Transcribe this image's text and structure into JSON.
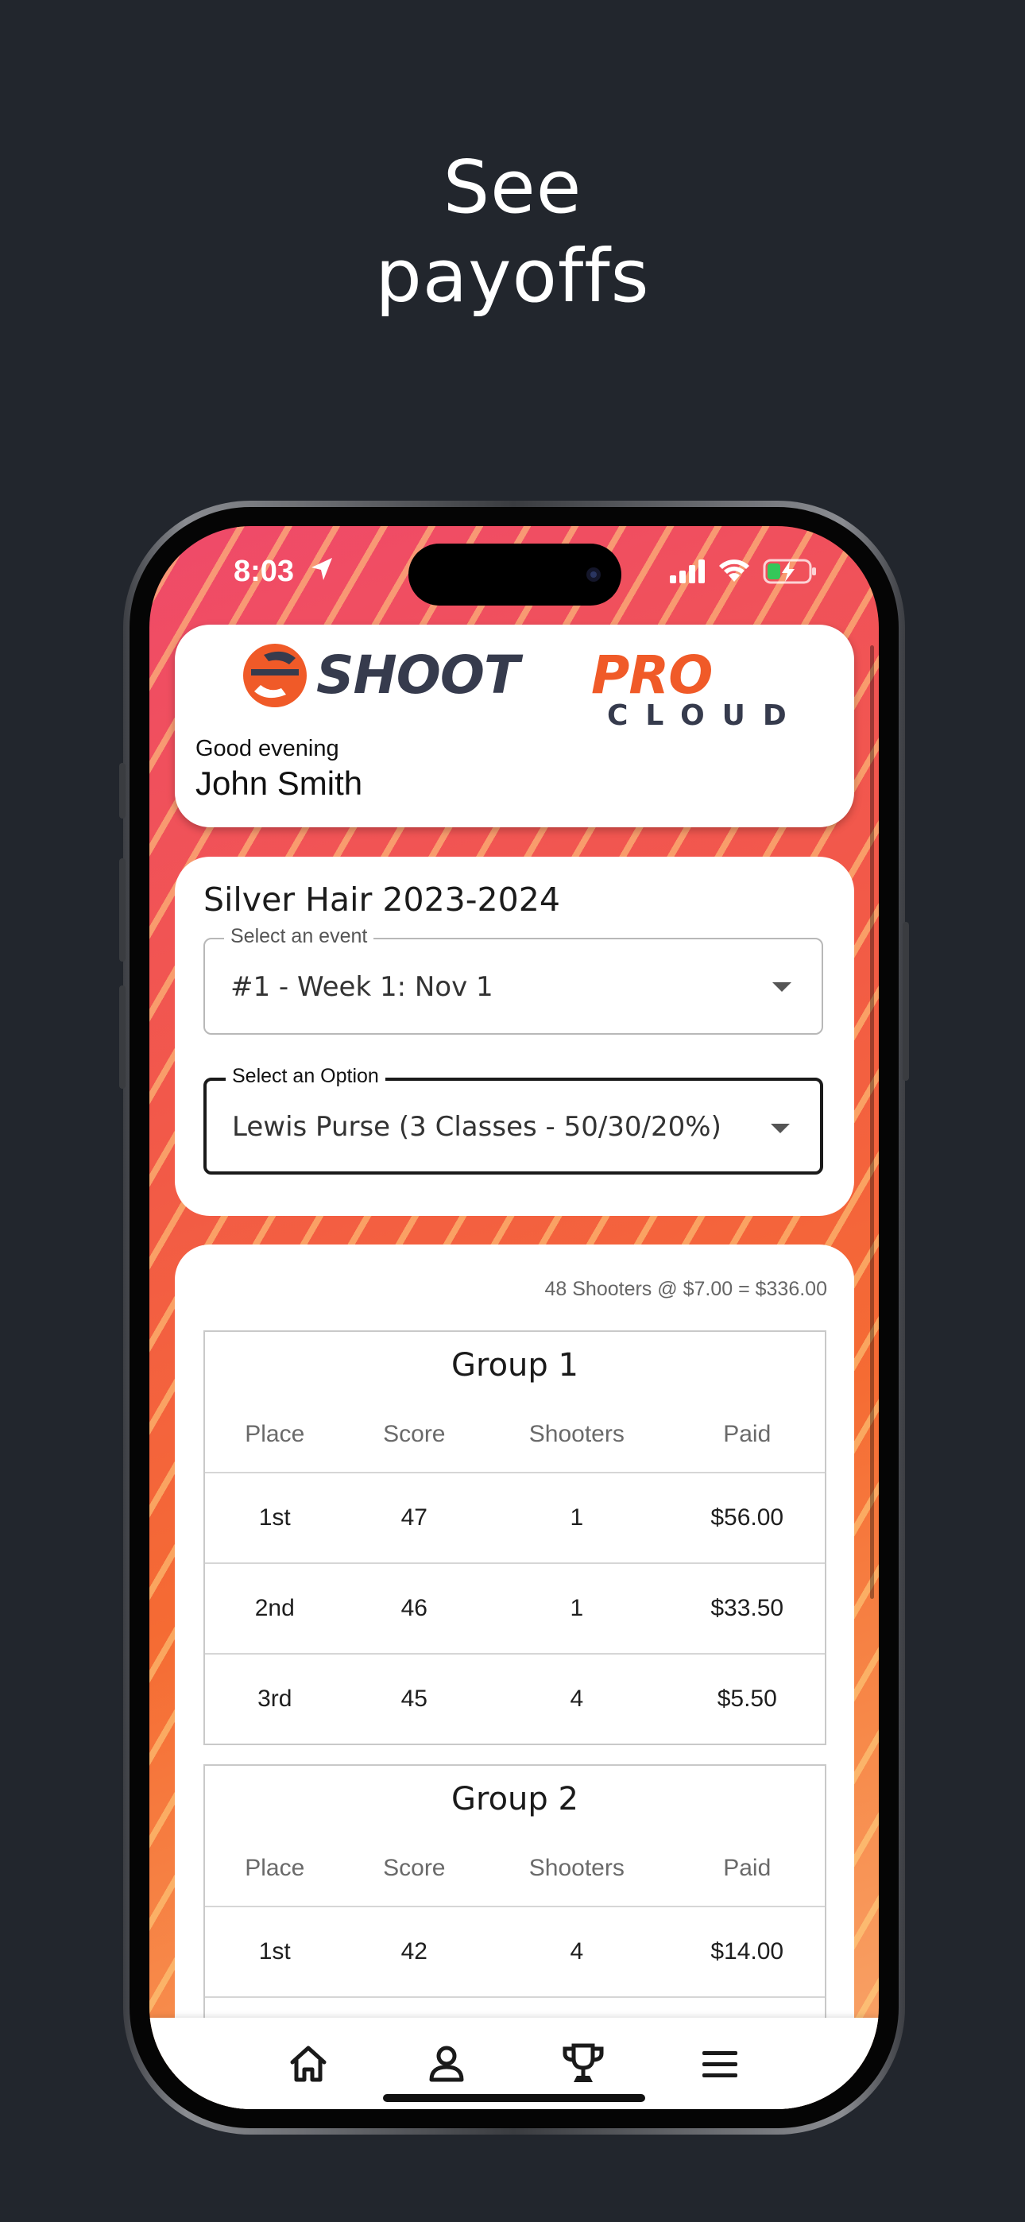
{
  "headline": {
    "line1": "See",
    "line2": "payoffs"
  },
  "status_bar": {
    "time": "8:03"
  },
  "header": {
    "logo_text": "SHOOTPRO",
    "logo_subtext": "CLOUD",
    "greeting": "Good evening",
    "user_name": "John Smith"
  },
  "league": {
    "title": "Silver Hair 2023-2024",
    "event_label": "Select an event",
    "event_value": "#1 - Week 1: Nov 1",
    "option_label": "Select an Option",
    "option_value": "Lewis Purse (3 Classes - 50/30/20%)"
  },
  "payout": {
    "summary": "48 Shooters @ $7.00 = $336.00",
    "columns": [
      "Place",
      "Score",
      "Shooters",
      "Paid"
    ],
    "groups": [
      {
        "title": "Group 1",
        "rows": [
          [
            "1st",
            "47",
            "1",
            "$56.00"
          ],
          [
            "2nd",
            "46",
            "1",
            "$33.50"
          ],
          [
            "3rd",
            "45",
            "4",
            "$5.50"
          ]
        ]
      },
      {
        "title": "Group 2",
        "rows": [
          [
            "1st",
            "42",
            "4",
            "$14.00"
          ]
        ]
      }
    ]
  },
  "nav": {
    "items": [
      "home-icon",
      "profile-icon",
      "trophy-icon",
      "menu-icon"
    ]
  },
  "colors": {
    "background": "#22262d",
    "accent_orange": "#f05a28",
    "brand_dark": "#363b4d"
  }
}
